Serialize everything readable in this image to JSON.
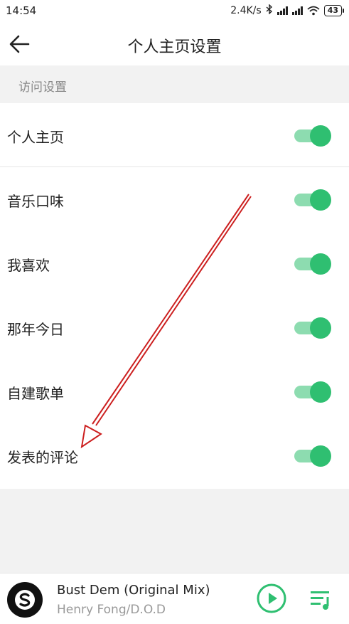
{
  "status_bar": {
    "time": "14:54",
    "net_speed": "2.4K/s",
    "battery": "43"
  },
  "header": {
    "title": "个人主页设置",
    "back_icon": "arrow-left-icon"
  },
  "section": {
    "title": "访问设置"
  },
  "settings": [
    {
      "label": "个人主页",
      "enabled": true
    },
    {
      "label": "音乐口味",
      "enabled": true
    },
    {
      "label": "我喜欢",
      "enabled": true
    },
    {
      "label": "那年今日",
      "enabled": true
    },
    {
      "label": "自建歌单",
      "enabled": true
    },
    {
      "label": "发表的评论",
      "enabled": true
    }
  ],
  "player": {
    "title": "Bust Dem (Original Mix)",
    "artist": "Henry Fong/D.O.D"
  },
  "colors": {
    "accent": "#2fbf71",
    "toggle_track": "#8ddcb0",
    "annotation": "#cc1f1f"
  }
}
